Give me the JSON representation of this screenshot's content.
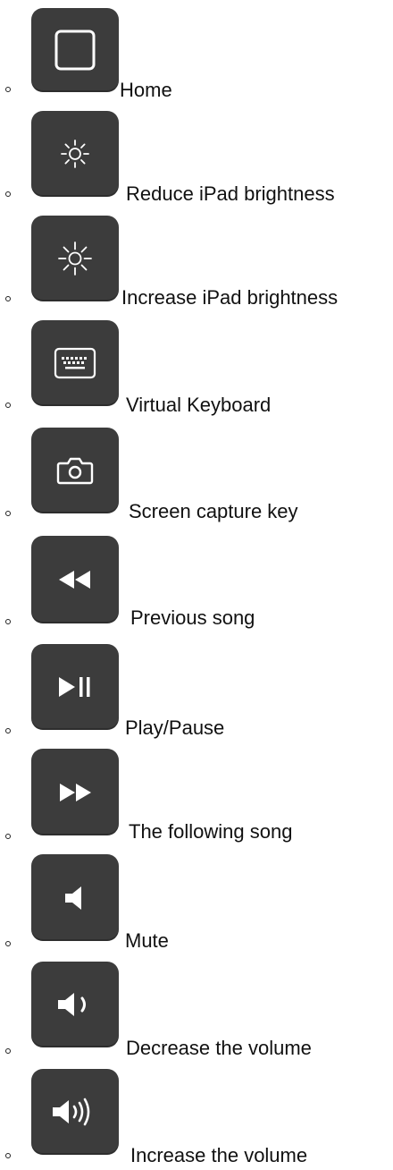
{
  "keys": [
    {
      "label": "Home",
      "icon": "home-square-icon"
    },
    {
      "label": "Reduce iPad brightness",
      "icon": "brightness-down-icon"
    },
    {
      "label": "Increase iPad brightness",
      "icon": "brightness-up-icon"
    },
    {
      "label": "Virtual Keyboard",
      "icon": "keyboard-icon"
    },
    {
      "label": "Screen capture key",
      "icon": "camera-icon"
    },
    {
      "label": "Previous song",
      "icon": "rewind-icon"
    },
    {
      "label": "Play/Pause",
      "icon": "play-pause-icon"
    },
    {
      "label": "The following song",
      "icon": "fast-forward-icon"
    },
    {
      "label": "Mute",
      "icon": "speaker-mute-icon"
    },
    {
      "label": "Decrease the volume",
      "icon": "volume-down-icon"
    },
    {
      "label": "Increase the volume",
      "icon": "volume-up-icon"
    }
  ],
  "colors": {
    "keycap": "#3c3c3c",
    "icon": "#ffffff",
    "text": "#111111"
  }
}
